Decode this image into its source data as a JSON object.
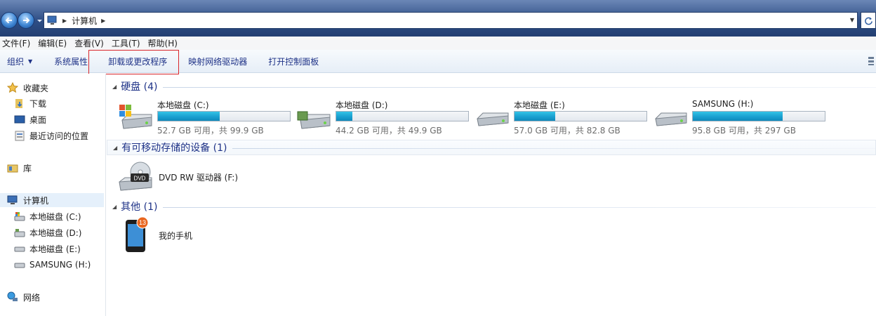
{
  "address": {
    "crumb": "计算机"
  },
  "menu": [
    {
      "label": "文件(F)"
    },
    {
      "label": "编辑(E)"
    },
    {
      "label": "查看(V)"
    },
    {
      "label": "工具(T)"
    },
    {
      "label": "帮助(H)"
    }
  ],
  "toolbar": {
    "organize": "组织",
    "properties": "系统属性",
    "uninstall": "卸载或更改程序",
    "map_drive": "映射网络驱动器",
    "control_panel": "打开控制面板"
  },
  "nav": {
    "favorites": "收藏夹",
    "downloads": "下载",
    "desktop": "桌面",
    "recent": "最近访问的位置",
    "libraries": "库",
    "computer": "计算机",
    "drive_c": "本地磁盘 (C:)",
    "drive_d": "本地磁盘 (D:)",
    "drive_e": "本地磁盘 (E:)",
    "drive_h": "SAMSUNG (H:)",
    "network": "网络"
  },
  "groups": {
    "hard_disks": "硬盘 (4)",
    "removable": "有可移动存储的设备 (1)",
    "other": "其他 (1)"
  },
  "drives": [
    {
      "name": "本地磁盘 (C:)",
      "free": "52.7 GB 可用，共 99.9 GB",
      "used_fraction": 0.47
    },
    {
      "name": "本地磁盘 (D:)",
      "free": "44.2 GB 可用，共 49.9 GB",
      "used_fraction": 0.12
    },
    {
      "name": "本地磁盘 (E:)",
      "free": "57.0 GB 可用，共 82.8 GB",
      "used_fraction": 0.31
    },
    {
      "name": "SAMSUNG (H:)",
      "free": "95.8 GB 可用，共 297 GB",
      "used_fraction": 0.68
    }
  ],
  "dvd": {
    "name": "DVD RW 驱动器 (F:)",
    "badge": "DVD"
  },
  "phone": {
    "name": "我的手机",
    "badge": "13"
  },
  "colors": {
    "accent": "#1e3287",
    "bar_fill": "#1aa0d0",
    "highlight_border": "#d9262b"
  }
}
